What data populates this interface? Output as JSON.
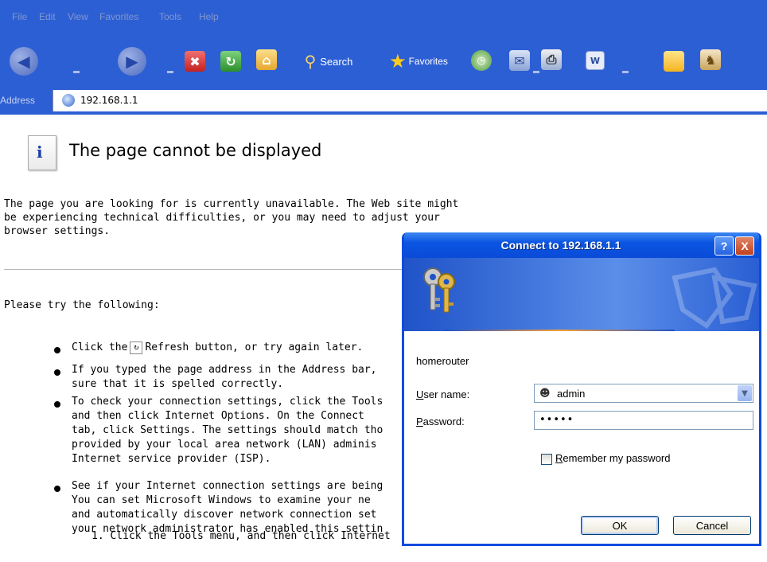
{
  "menu": [
    "File",
    "Edit",
    "View",
    "Favorites",
    "Tools",
    "Help"
  ],
  "toolbar": {
    "back_icon": "back-arrow-icon",
    "forward_icon": "forward-arrow-icon",
    "search_label": "Search",
    "favorites_label": "Favorites"
  },
  "address": {
    "label": "Address",
    "url": "192.168.1.1"
  },
  "page": {
    "title": "The page cannot be displayed",
    "intro": "The page you are looking for is currently unavailable. The Web site might be experiencing technical difficulties, or you may need to adjust your browser settings.",
    "try": "Please try the following:",
    "bullets": [
      [
        "Click the",
        "Refresh button, or try again later."
      ],
      [
        "If you typed the page address in the Address bar,",
        "sure that it is spelled correctly."
      ],
      [
        "To check your connection settings, click the Tools",
        "and then click Internet Options. On the Connect",
        "tab, click Settings. The settings should match tho",
        "provided by your local area network (LAN) adminis",
        "Internet service provider (ISP)."
      ],
      [
        "See if your Internet connection settings are being",
        "You can set Microsoft Windows to examine your ne",
        "and automatically discover network connection set",
        "your network administrator has enabled this settin"
      ]
    ],
    "numbered": "1.  Click the Tools menu, and then click Internet"
  },
  "dialog": {
    "title": "Connect to 192.168.1.1",
    "help": "?",
    "close": "X",
    "realm": "homerouter",
    "username_label": "User name:",
    "username_value": "admin",
    "password_label": "Password:",
    "password_value": "•••••",
    "remember_label": "Remember my password",
    "ok_label": "OK",
    "cancel_label": "Cancel"
  }
}
